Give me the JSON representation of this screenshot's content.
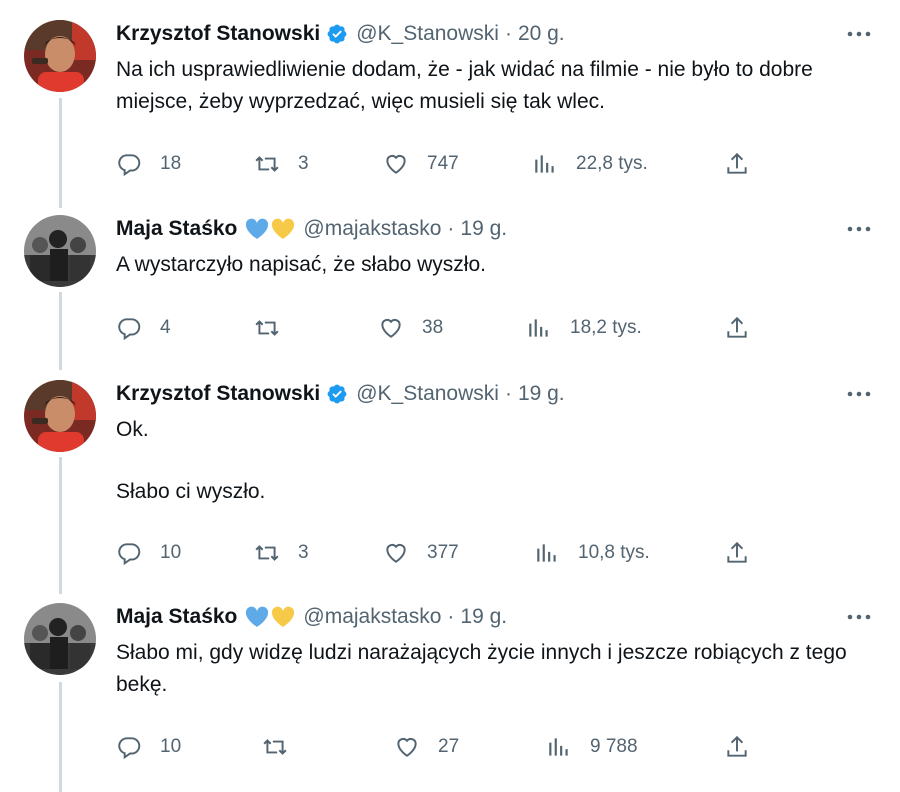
{
  "colors": {
    "verified": "#1d9bf0",
    "text": "#0f1419",
    "muted": "#536471",
    "thread_line": "#cfd9de",
    "heart_blue": "#5ea9e8",
    "heart_yellow": "#f7c948"
  },
  "tweets": [
    {
      "name": "Krzysztof Stanowski",
      "handle": "@K_Stanowski",
      "time": "20 g.",
      "paragraphs": [
        "Na ich usprawiedliwienie dodam, że - jak widać na filmie - nie było to dobre miejsce, żeby wyprzedzać, więc musieli się tak wlec."
      ],
      "replies": "18",
      "retweets": "3",
      "likes": "747",
      "views": "22,8 tys."
    },
    {
      "name": "Maja Staśko",
      "handle": "@majakstasko",
      "time": "19 g.",
      "paragraphs": [
        "A wystarczyło napisać, że słabo wyszło."
      ],
      "replies": "4",
      "retweets": "",
      "likes": "38",
      "views": "18,2 tys."
    },
    {
      "name": "Krzysztof Stanowski",
      "handle": "@K_Stanowski",
      "time": "19 g.",
      "paragraphs": [
        "Ok.",
        "Słabo ci wyszło."
      ],
      "replies": "10",
      "retweets": "3",
      "likes": "377",
      "views": "10,8 tys."
    },
    {
      "name": "Maja Staśko",
      "handle": "@majakstasko",
      "time": "19 g.",
      "paragraphs": [
        "Słabo mi, gdy widzę ludzi narażających życie innych i jeszcze robiących z tego bekę."
      ],
      "replies": "10",
      "retweets": "",
      "likes": "27",
      "views": "9 788"
    }
  ]
}
